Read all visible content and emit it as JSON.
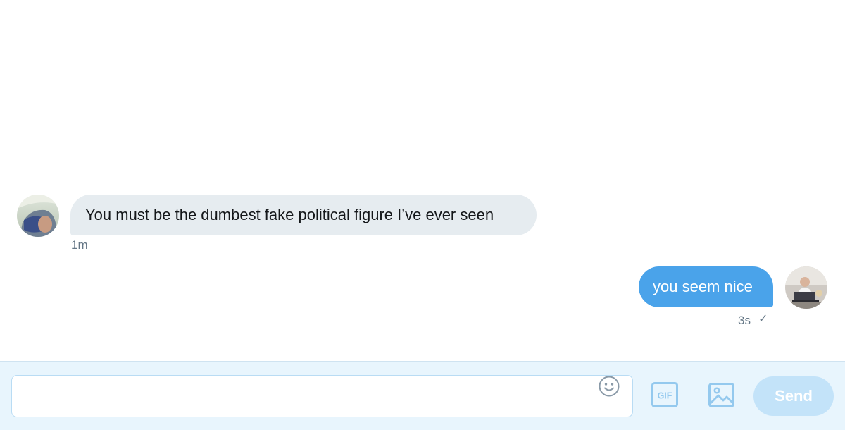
{
  "conversation": {
    "messages": [
      {
        "direction": "incoming",
        "text": "You must be the dumbest fake political figure I’ve ever seen",
        "time": "1m"
      },
      {
        "direction": "outgoing",
        "text": "you seem nice",
        "time": "3s",
        "status_icon": "checkmark-icon",
        "status_glyph": "✓"
      }
    ]
  },
  "composer": {
    "input_value": "",
    "input_placeholder": "",
    "emoji_icon": "emoji-icon",
    "gif_icon": "gif-icon",
    "gif_label": "GIF",
    "media_icon": "image-icon",
    "send_label": "Send"
  },
  "colors": {
    "incoming_bubble": "#e6ecf0",
    "outgoing_bubble": "#4aa3ea",
    "composer_bg": "#e8f5fd",
    "send_disabled": "#c3e3f9",
    "icon_blue": "#94c9ee",
    "meta_text": "#657786"
  }
}
